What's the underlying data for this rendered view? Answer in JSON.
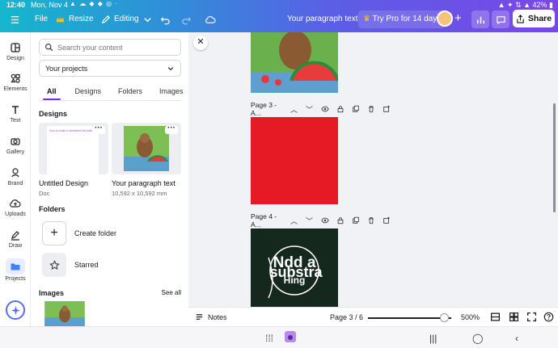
{
  "status": {
    "time": "12:40",
    "date": "Mon, Nov 4",
    "battery": "42%"
  },
  "toolbar": {
    "menu_label": "File",
    "resize_label": "Resize",
    "editing_label": "Editing",
    "doc_title": "Your paragraph text",
    "pro_label": "Try Pro for 14 days",
    "share_label": "Share"
  },
  "rail": [
    {
      "label": "Design",
      "icon": "layout-icon"
    },
    {
      "label": "Elements",
      "icon": "shapes-icon"
    },
    {
      "label": "Text",
      "icon": "text-icon"
    },
    {
      "label": "Gallery",
      "icon": "camera-icon"
    },
    {
      "label": "Brand",
      "icon": "brand-icon"
    },
    {
      "label": "Uploads",
      "icon": "cloud-upload-icon"
    },
    {
      "label": "Draw",
      "icon": "pen-icon"
    },
    {
      "label": "Projects",
      "icon": "folder-icon",
      "active": true
    }
  ],
  "panel": {
    "search_placeholder": "Search your content",
    "projects_select": "Your projects",
    "tabs": [
      "All",
      "Designs",
      "Folders",
      "Images"
    ],
    "active_tab": "All",
    "designs_heading": "Designs",
    "designs": [
      {
        "title": "Untitled Design",
        "subtitle": "Doc",
        "thumb_text": "How to make a shredded fruit table?"
      },
      {
        "title": "Your paragraph text",
        "subtitle": "10,592 x 10,592 mm"
      }
    ],
    "folders_heading": "Folders",
    "create_folder_label": "Create folder",
    "starred_label": "Starred",
    "images_heading": "Images",
    "see_all_label": "See all"
  },
  "pages": [
    {
      "label": "Page 3 - A..."
    },
    {
      "label": "Page 4 - A..."
    }
  ],
  "footer": {
    "notes_label": "Notes",
    "page_indicator": "Page 3 / 6",
    "zoom_label": "500%",
    "zoom_fraction": 0.92
  },
  "colors": {
    "accent": "#7d2ae8",
    "page3_fill": "#e61a24",
    "page4_fill": "#14281e",
    "topbar_start": "#16b6cd",
    "topbar_end": "#7a46e8"
  }
}
